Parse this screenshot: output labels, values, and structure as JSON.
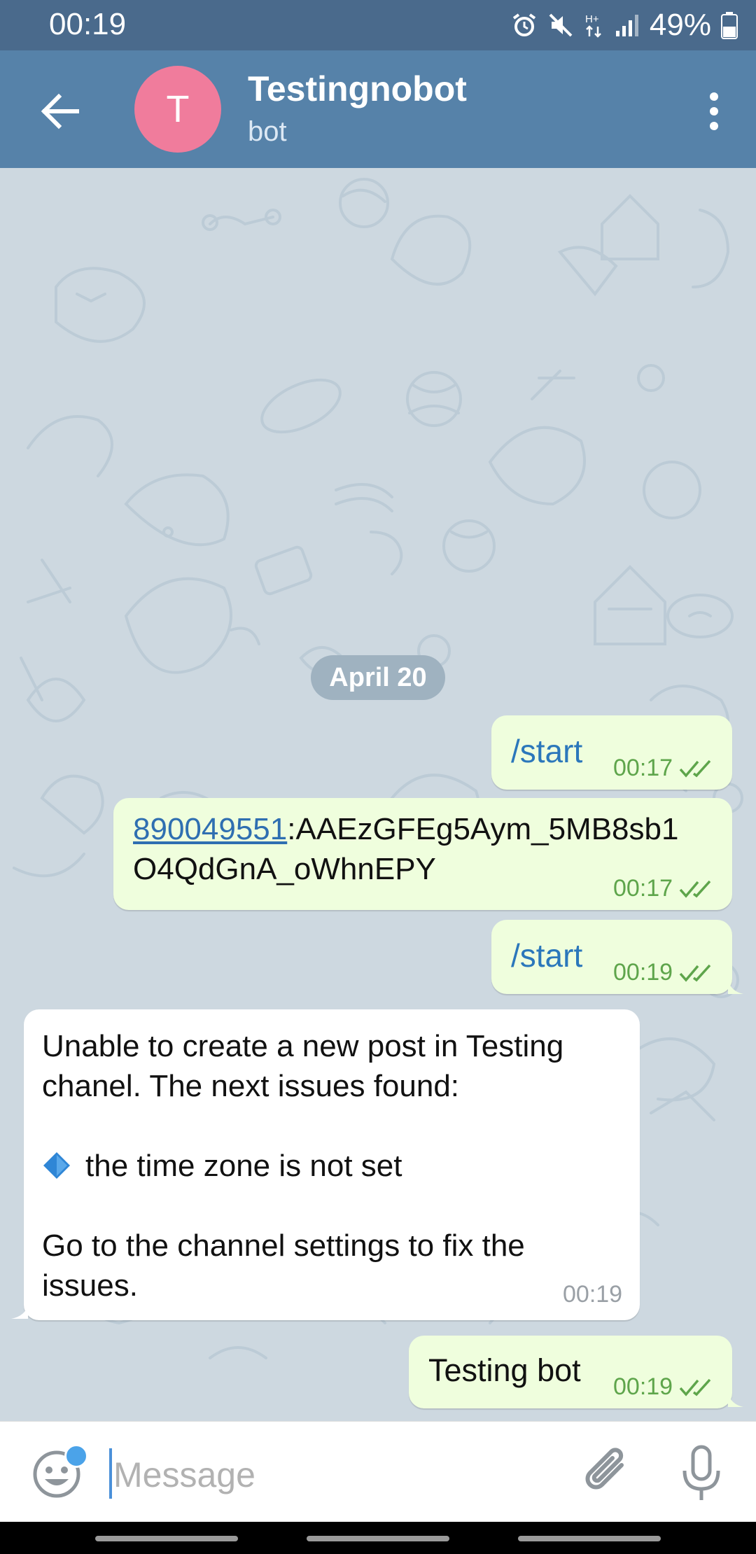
{
  "status_bar": {
    "time": "00:19",
    "battery": "49%",
    "icons": [
      "alarm-icon",
      "mute-icon",
      "network-hplus-icon",
      "signal-icon",
      "battery-icon"
    ]
  },
  "header": {
    "avatar_letter": "T",
    "title": "Testingnobot",
    "subtitle": "bot",
    "avatar_color": "#f07c9c",
    "header_color": "#5682a9"
  },
  "chat": {
    "date": "April 20",
    "messages": [
      {
        "direction": "out",
        "text": "/start",
        "time": "00:17",
        "status": "read"
      },
      {
        "direction": "out",
        "link": "890049551",
        "text_line1": ":AAEzGFEg5Aym_5MB8sb1",
        "text_line2": "O4QdGnA_oWhnEPY",
        "time": "00:17",
        "status": "read"
      },
      {
        "direction": "out",
        "text": "/start",
        "time": "00:19",
        "status": "read"
      },
      {
        "direction": "in",
        "lines": [
          "Unable to create a new post in Testing",
          "chanel. The next issues found:",
          "",
          "the time zone is not set",
          "",
          "Go to the channel settings to fix the",
          "issues."
        ],
        "bullet_icon": "blue-diamond-icon",
        "time": "00:19"
      },
      {
        "direction": "out",
        "text": "Testing bot",
        "time": "00:19",
        "status": "read"
      }
    ]
  },
  "input": {
    "placeholder": "Message",
    "value": ""
  },
  "colors": {
    "outgoing_bubble": "#effedd",
    "incoming_bubble": "#ffffff",
    "command_blue": "#2b77bb",
    "check_green": "#5ea54b"
  }
}
